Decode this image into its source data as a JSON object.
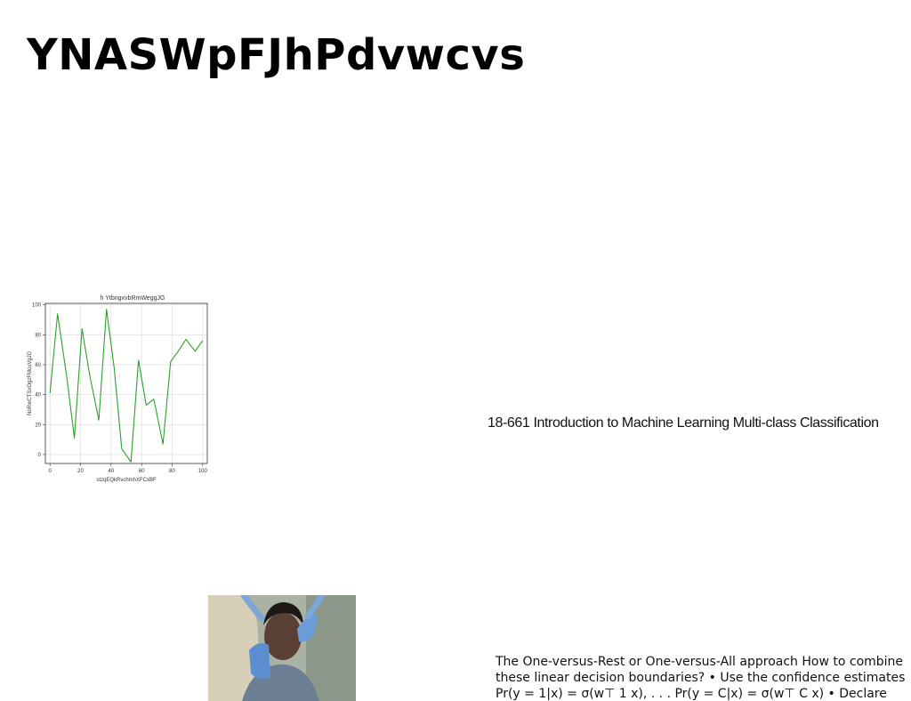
{
  "page": {
    "title": "YNASWpFJhPdvwcvs",
    "caption": "18-661 Introduction to Machine Learning Multi-class Classification",
    "body_text": "The One-versus-Rest or One-versus-All approach How to combine these linear decision boundaries? • Use the confidence estimates Pr(y = 1|x) = σ(w⊤ 1 x), . . . Pr(y = C|x) = σ(w⊤ C x) • Declare class c⋆ that"
  },
  "colors": {
    "line": "#2ca02c",
    "grid": "#d9d9d9"
  },
  "chart_data": {
    "type": "line",
    "title": "h YtbngxvbRmWeggJG",
    "xlabel": "stzqEQkRvchmhXFCxBF",
    "ylabel": "NoRwCTSxOgzFMcuVgJD",
    "xlim": [
      -3,
      103
    ],
    "ylim": [
      -6,
      101
    ],
    "xticks": [
      0,
      20,
      40,
      60,
      80,
      100
    ],
    "yticks": [
      0,
      20,
      40,
      60,
      80,
      100
    ],
    "grid": true,
    "series": [
      {
        "x": [
          0,
          5,
          11,
          16,
          21,
          26,
          32,
          37,
          42,
          47,
          53,
          58,
          63,
          68,
          74,
          79,
          84,
          89,
          95,
          100
        ],
        "values": [
          41,
          94,
          52,
          11,
          84,
          53,
          23,
          97,
          58,
          4,
          -5,
          63,
          33,
          37,
          7,
          62,
          69,
          77,
          69,
          76
        ]
      }
    ]
  }
}
